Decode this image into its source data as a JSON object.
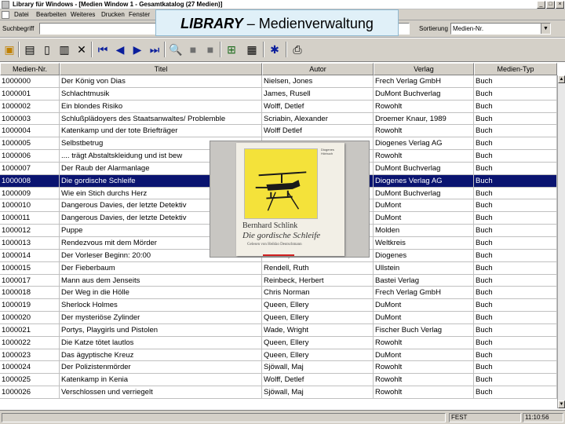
{
  "window": {
    "title": "Library für Windows - [Medien Window 1 - Gesamtkatalog (27 Medien)]",
    "controls": [
      "_",
      "□",
      "×"
    ]
  },
  "menu": {
    "items": [
      "Datei",
      "Bearbeiten",
      "Weiteres",
      "Drucken",
      "Fenster",
      "Hilfe"
    ],
    "mdi_controls": [
      "_",
      "□",
      "×"
    ]
  },
  "banner": {
    "bold": "LIBRARY",
    "rest": " – Medienverwaltung"
  },
  "search": {
    "label": "Suchbegriff",
    "value": "",
    "sort_label": "Sortierung",
    "sort_value": "Medien-Nr."
  },
  "toolbar": {
    "icons": [
      "open-folder",
      "new-record",
      "new-document",
      "paste",
      "delete",
      "first",
      "previous",
      "next",
      "last",
      "find",
      "view-gray-1",
      "view-gray-2",
      "tree",
      "properties",
      "network",
      "print"
    ]
  },
  "table": {
    "columns": [
      "Medien-Nr.",
      "Titel",
      "Autor",
      "Verlag",
      "Medien-Typ"
    ],
    "selected_index": 8,
    "rows": [
      [
        "1000000",
        "Der König von Dias",
        "Nielsen, Jones",
        "Frech Verlag GmbH",
        "Buch"
      ],
      [
        "1000001",
        "Schlachtmusik",
        "James, Rusell",
        "DuMont Buchverlag",
        "Buch"
      ],
      [
        "1000002",
        "Ein blondes Risiko",
        "Wolff, Detlef",
        "Rowohlt",
        "Buch"
      ],
      [
        "1000003",
        "Schlußplädoyers des Staatsanwaltes/ Problemble",
        "Scriabin, Alexander",
        "Droemer Knaur, 1989",
        "Buch"
      ],
      [
        "1000004",
        "Katenkamp und der tote Briefträger",
        "Wolff Detlef",
        "Rowohlt",
        "Buch"
      ],
      [
        "1000005",
        "Selbstbetrug",
        "",
        "Diogenes Verlag AG",
        "Buch"
      ],
      [
        "1000006",
        ".... trägt Abstaltskleidung und ist bew",
        "",
        "Rowohlt",
        "Buch"
      ],
      [
        "1000007",
        "Der Raub der Alarmanlage",
        "",
        "DuMont Buchverlag",
        "Buch"
      ],
      [
        "1000008",
        "Die gordische Schleife",
        "",
        "Diogenes Verlag AG",
        "Buch"
      ],
      [
        "1000009",
        "Wie ein Stich durchs Herz",
        "",
        "DuMont Buchverlag",
        "Buch"
      ],
      [
        "1000010",
        "Dangerous Davies, der letzte Detektiv",
        "",
        "DuMont",
        "Buch"
      ],
      [
        "1000011",
        "Dangerous Davies, der letzte Detektiv",
        "",
        "DuMont",
        "Buch"
      ],
      [
        "1000012",
        "Puppe",
        "",
        "Molden",
        "Buch"
      ],
      [
        "1000013",
        "Rendezvous mit dem Mörder",
        "",
        "Weltkreis",
        "Buch"
      ],
      [
        "1000014",
        "Der Vorleser Beginn: 20:00",
        "Schlink, Bernhard",
        "Diogenes",
        "Buch"
      ],
      [
        "1000015",
        "Der Fieberbaum",
        "Rendell, Ruth",
        "Ullstein",
        "Buch"
      ],
      [
        "1000017",
        "Mann aus dem Jenseits",
        "Reinbeck, Herbert",
        "Bastei Verlag",
        "Buch"
      ],
      [
        "1000018",
        "Der Weg in die Hölle",
        "Chris Norman",
        "Frech Verlag GmbH",
        "Buch"
      ],
      [
        "1000019",
        "Sherlock Holmes",
        "Queen, Ellery",
        "DuMont",
        "Buch"
      ],
      [
        "1000020",
        "Der mysteriöse Zylinder",
        "Queen, Ellery",
        "DuMont",
        "Buch"
      ],
      [
        "1000021",
        "Portys, Playgirls und Pistolen",
        "Wade, Wright",
        "Fischer Buch Verlag",
        "Buch"
      ],
      [
        "1000022",
        "Die Katze tötet lautlos",
        "Queen, Ellery",
        "Rowohlt",
        "Buch"
      ],
      [
        "1000023",
        "Das ägyptische Kreuz",
        "Queen, Ellery",
        "DuMont",
        "Buch"
      ],
      [
        "1000024",
        "Der Polizistenmörder",
        "Sjöwall, Maj",
        "Rowohlt",
        "Buch"
      ],
      [
        "1000025",
        "Katenkamp in Kenia",
        "Wolff, Detlef",
        "Rowohlt",
        "Buch"
      ],
      [
        "1000026",
        "Verschlossen und verriegelt",
        "Sjöwall, Maj",
        "Rowohlt",
        "Buch"
      ]
    ]
  },
  "cover": {
    "author": "Bernhard Schlink",
    "title": "Die gordische Schleife",
    "subtitle": "Gelesen von Heikko Deutschmann",
    "publisher_label": "Diogenes Hörbuch"
  },
  "status": {
    "mode": "FEST",
    "time": "11:10:56"
  }
}
